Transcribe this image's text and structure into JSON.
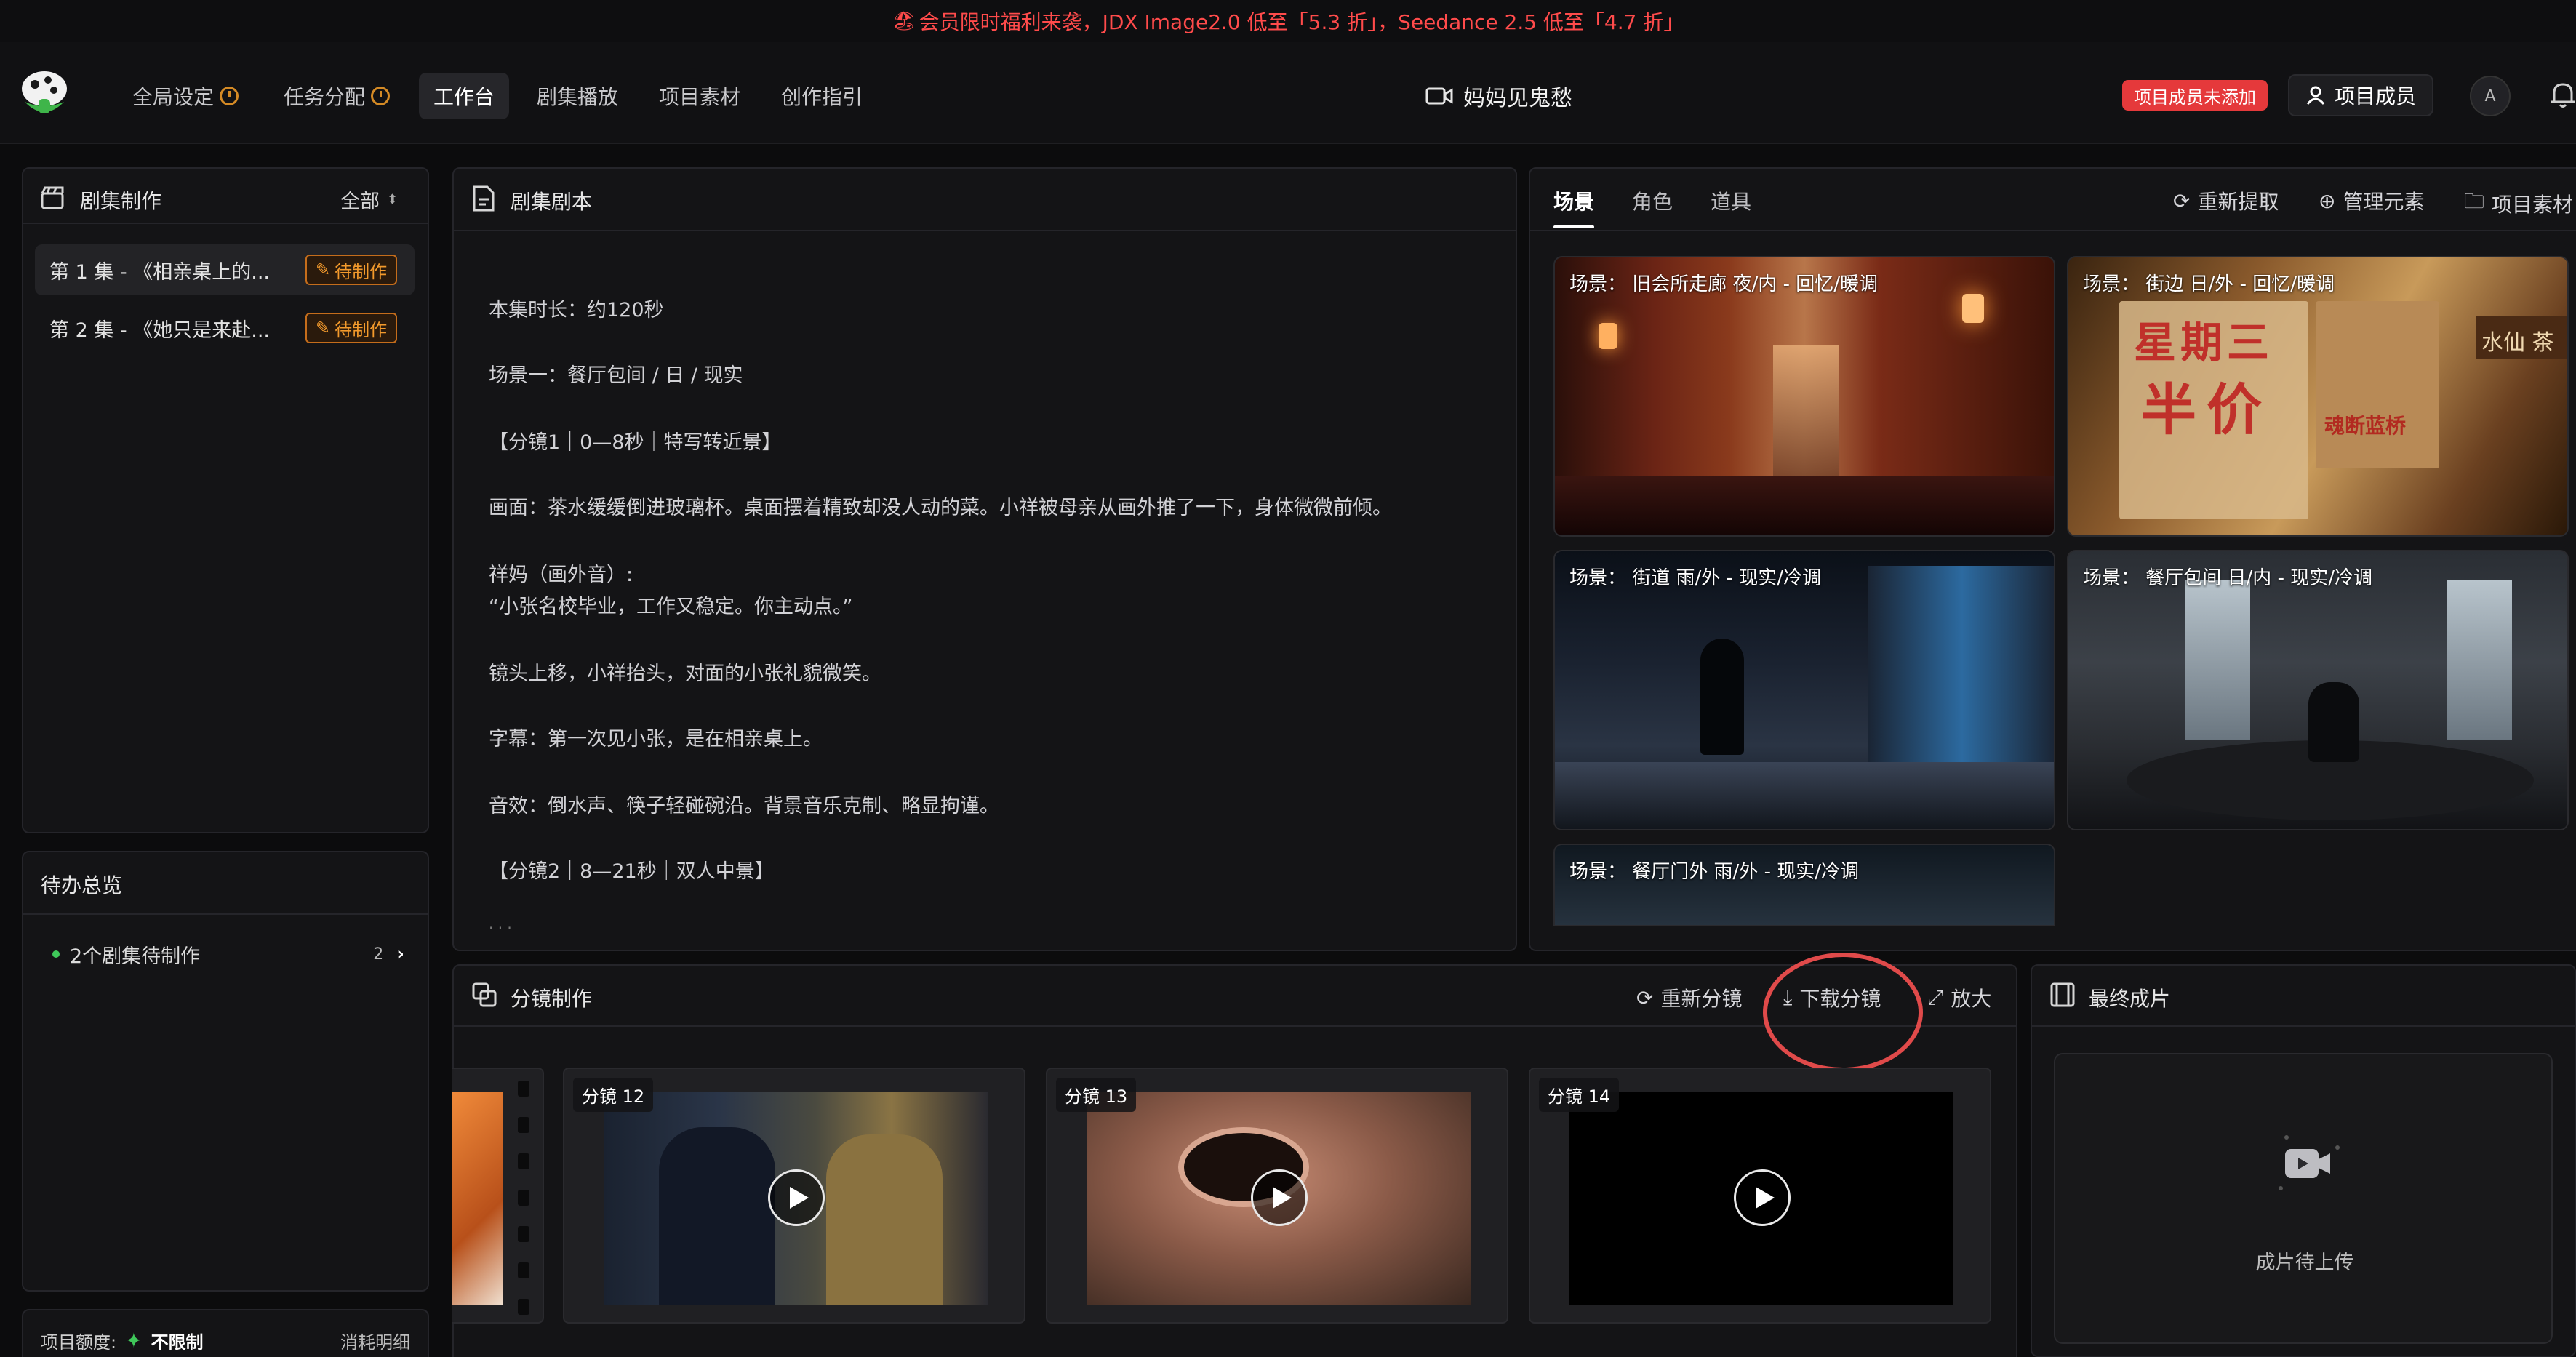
{
  "promo": {
    "emoji": "🏖",
    "text": "会员限时福利来袭，JDX Image2.0 低至「5.3 折」，Seedance 2.5 低至「4.7 折」"
  },
  "nav": {
    "items": [
      {
        "label": "全局设定",
        "has_clock": true
      },
      {
        "label": "任务分配",
        "has_clock": true
      },
      {
        "label": "工作台",
        "active": true
      },
      {
        "label": "剧集播放"
      },
      {
        "label": "项目素材"
      },
      {
        "label": "创作指引"
      }
    ],
    "project_title": "妈妈见鬼愁",
    "warn_badge": "项目成员未添加",
    "members_label": "项目成员",
    "avatar_letter": "A"
  },
  "episodes": {
    "title": "剧集制作",
    "filter": "全部",
    "items": [
      {
        "label": "第 1 集 - 《相亲桌上的...",
        "status": "待制作"
      },
      {
        "label": "第 2 集 - 《她只是来赴...",
        "status": "待制作"
      }
    ]
  },
  "todo": {
    "title": "待办总览",
    "item_label": "2个剧集待制作",
    "item_count": "2"
  },
  "quota": {
    "label": "项目额度:",
    "value": "不限制",
    "detail": "消耗明细"
  },
  "script": {
    "title": "剧集剧本",
    "lines": [
      "本集时长：约120秒",
      "场景一：餐厅包间 / 日 / 现实",
      "【分镜1｜0—8秒｜特写转近景】",
      "画面：茶水缓缓倒进玻璃杯。桌面摆着精致却没人动的菜。小祥被母亲从画外推了一下，身体微微前倾。",
      "祥妈（画外音）:",
      "“小张名校毕业，工作又稳定。你主动点。”",
      "镜头上移，小祥抬头，对面的小张礼貌微笑。",
      "字幕：第一次见小张，是在相亲桌上。",
      "音效：倒水声、筷子轻碰碗沿。背景音乐克制、略显拘谨。",
      "【分镜2｜8—21秒｜双人中景】"
    ]
  },
  "elements": {
    "tabs": [
      "场景",
      "角色",
      "道具"
    ],
    "actions": [
      "重新提取",
      "管理元素",
      "项目素材"
    ],
    "scenes": [
      {
        "prefix": "场景：",
        "name": "旧会所走廊 夜/内 - 回忆/暖调"
      },
      {
        "prefix": "场景：",
        "name": "街边 日/外 - 回忆/暖调"
      },
      {
        "prefix": "场景：",
        "name": "街道 雨/外 - 现实/冷调"
      },
      {
        "prefix": "场景：",
        "name": "餐厅包间 日/内 - 现实/冷调"
      },
      {
        "prefix": "场景：",
        "name": "餐厅门外 雨/外 - 现实/冷调"
      }
    ],
    "poster_text": {
      "line1": "星期三",
      "line2": "半价",
      "sign1": "水仙",
      "sign2": "茶",
      "sign3": "魂断蓝桥"
    }
  },
  "storyboard": {
    "title": "分镜制作",
    "actions": [
      "重新分镜",
      "下载分镜",
      "放大"
    ],
    "shots": [
      "分镜 12",
      "分镜 13",
      "分镜 14"
    ]
  },
  "final": {
    "title": "最终成片",
    "placeholder": "成片待上传"
  },
  "colors": {
    "accent_orange": "#f39a2c",
    "warn_red": "#e5393b",
    "promo_red": "#ff4b4b",
    "highlight_circle": "#e04a4a"
  }
}
